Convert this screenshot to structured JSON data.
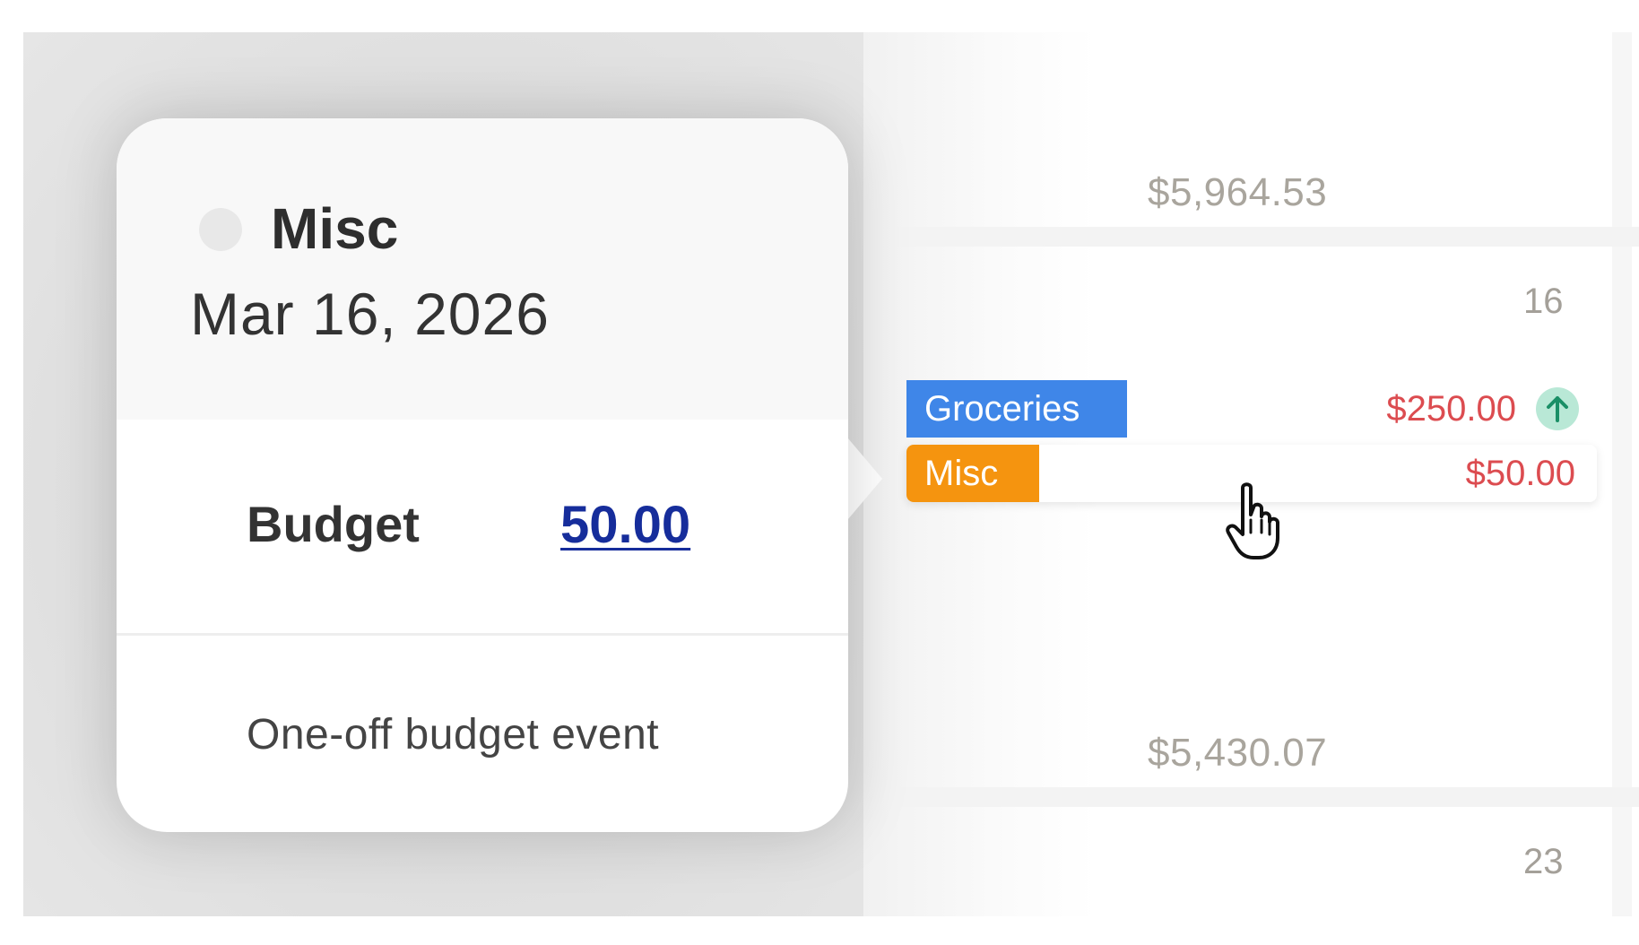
{
  "popover": {
    "title": "Misc",
    "date": "Mar 16, 2026",
    "budget_label": "Budget",
    "budget_value": "50.00",
    "note": "One-off budget event"
  },
  "calendar": {
    "balance_top": "$5,964.53",
    "day_1": "16",
    "events": [
      {
        "name": "Groceries",
        "amount": "$250.00",
        "color": "#3f86e8",
        "icon": "arrow-up-icon"
      },
      {
        "name": "Misc",
        "amount": "$50.00",
        "color": "#f5940f"
      }
    ],
    "balance_bottom": "$5,430.07",
    "day_2": "23"
  },
  "colors": {
    "amount_negative": "#dc4c50",
    "link": "#162d9b",
    "icon_bg": "#b9e8d6",
    "icon_fg": "#1a8f66"
  }
}
